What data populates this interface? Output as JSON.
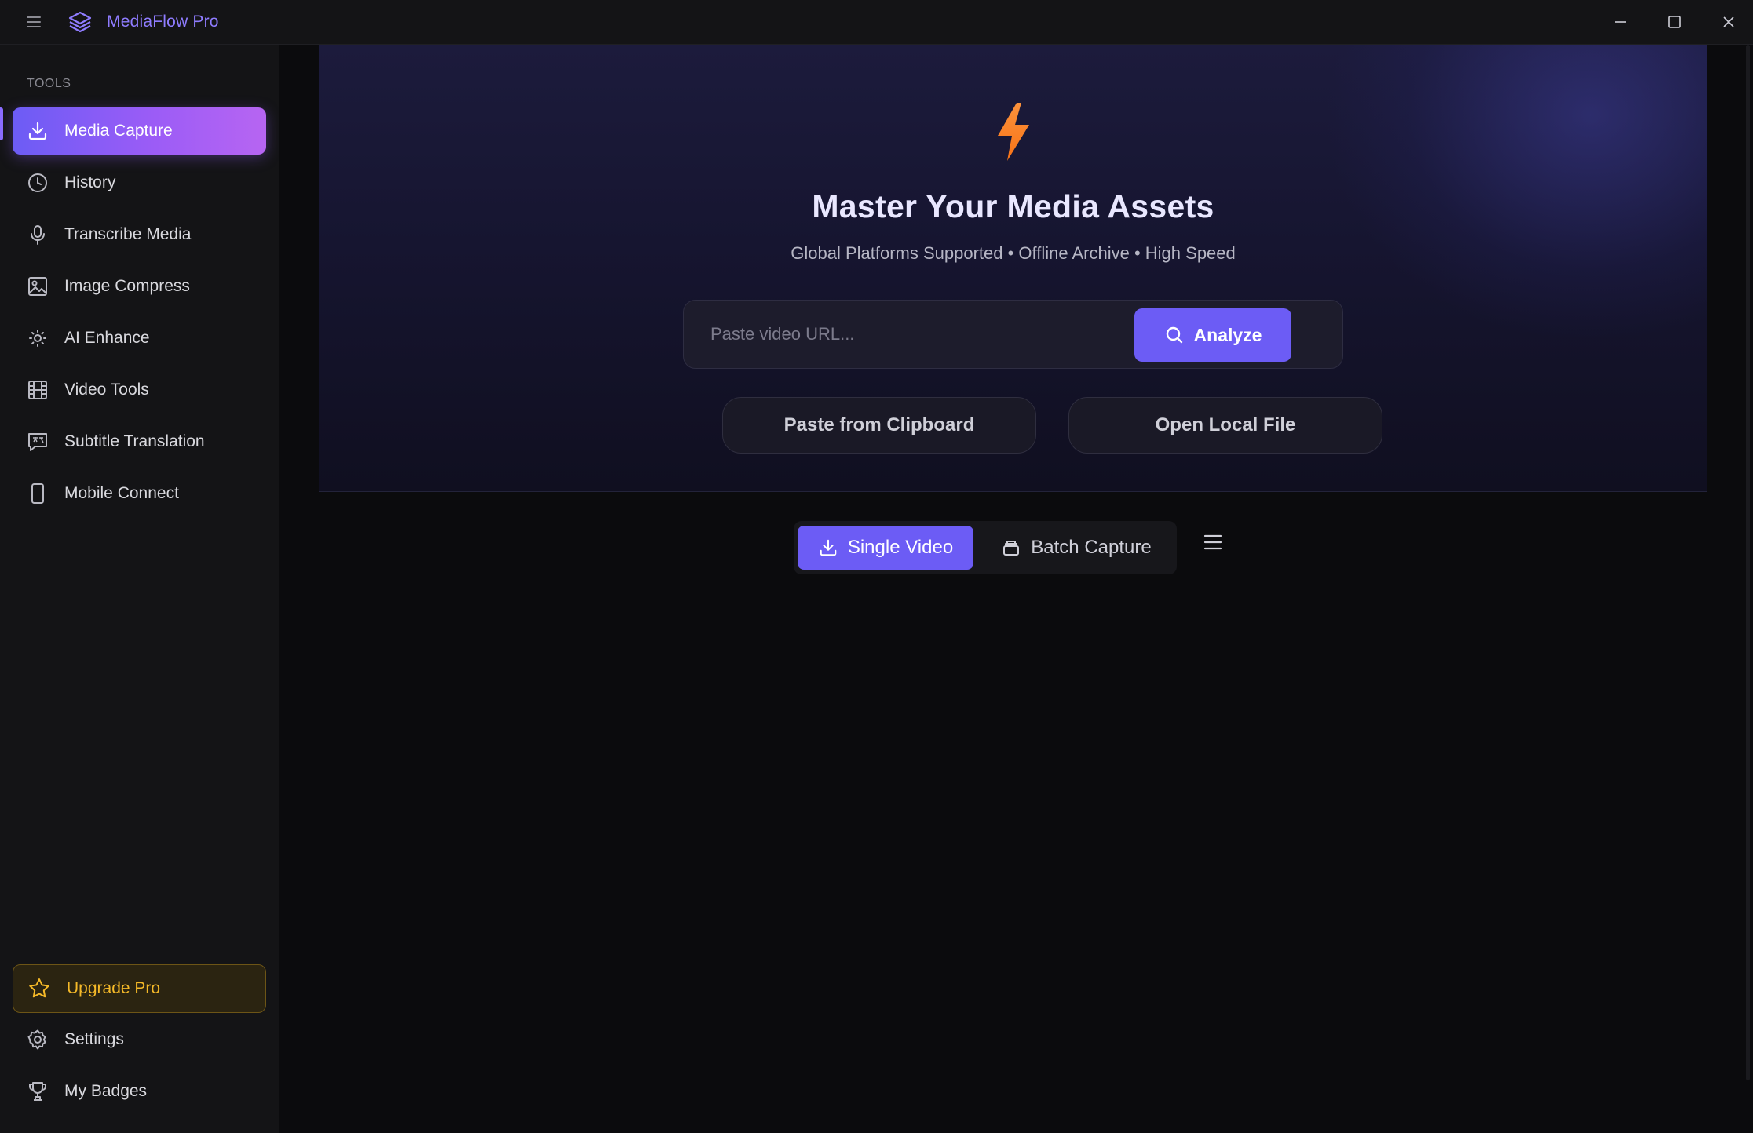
{
  "app": {
    "title": "MediaFlow Pro",
    "accent_color": "#6c5cf5",
    "icons": {
      "menu": "hamburger-icon",
      "logo": "layers-icon",
      "minimize": "minimize-icon",
      "maximize": "maximize-icon",
      "close": "close-icon"
    }
  },
  "sidebar": {
    "heading": "TOOLS",
    "items": [
      {
        "label": "Media Capture",
        "icon": "download-icon",
        "active": true
      },
      {
        "label": "History",
        "icon": "clock-icon"
      },
      {
        "label": "Transcribe Media",
        "icon": "microphone-icon"
      },
      {
        "label": "Image Compress",
        "icon": "image-icon"
      },
      {
        "label": "AI Enhance",
        "icon": "sun-icon"
      },
      {
        "label": "Video Tools",
        "icon": "film-icon"
      },
      {
        "label": "Subtitle Translation",
        "icon": "translate-icon"
      },
      {
        "label": "Mobile Connect",
        "icon": "phone-icon"
      }
    ],
    "upgrade": {
      "label": "Upgrade Pro",
      "icon": "star-icon",
      "color": "#f5b928"
    },
    "footer": [
      {
        "label": "Settings",
        "icon": "gear-icon"
      },
      {
        "label": "My Badges",
        "icon": "trophy-icon"
      }
    ]
  },
  "hero": {
    "icon": "lightning-bolt-icon",
    "icon_color": "#f97316",
    "title": "Master Your Media Assets",
    "subtitle": "Global Platforms Supported • Offline Archive • High Speed",
    "url_input": {
      "placeholder": "Paste video URL...",
      "value": ""
    },
    "analyze_label": "Analyze",
    "paste_label": "Paste from Clipboard",
    "local_label": "Open Local File"
  },
  "mode": {
    "single_label": "Single Video",
    "batch_label": "Batch Capture",
    "selected": "Single Video"
  }
}
